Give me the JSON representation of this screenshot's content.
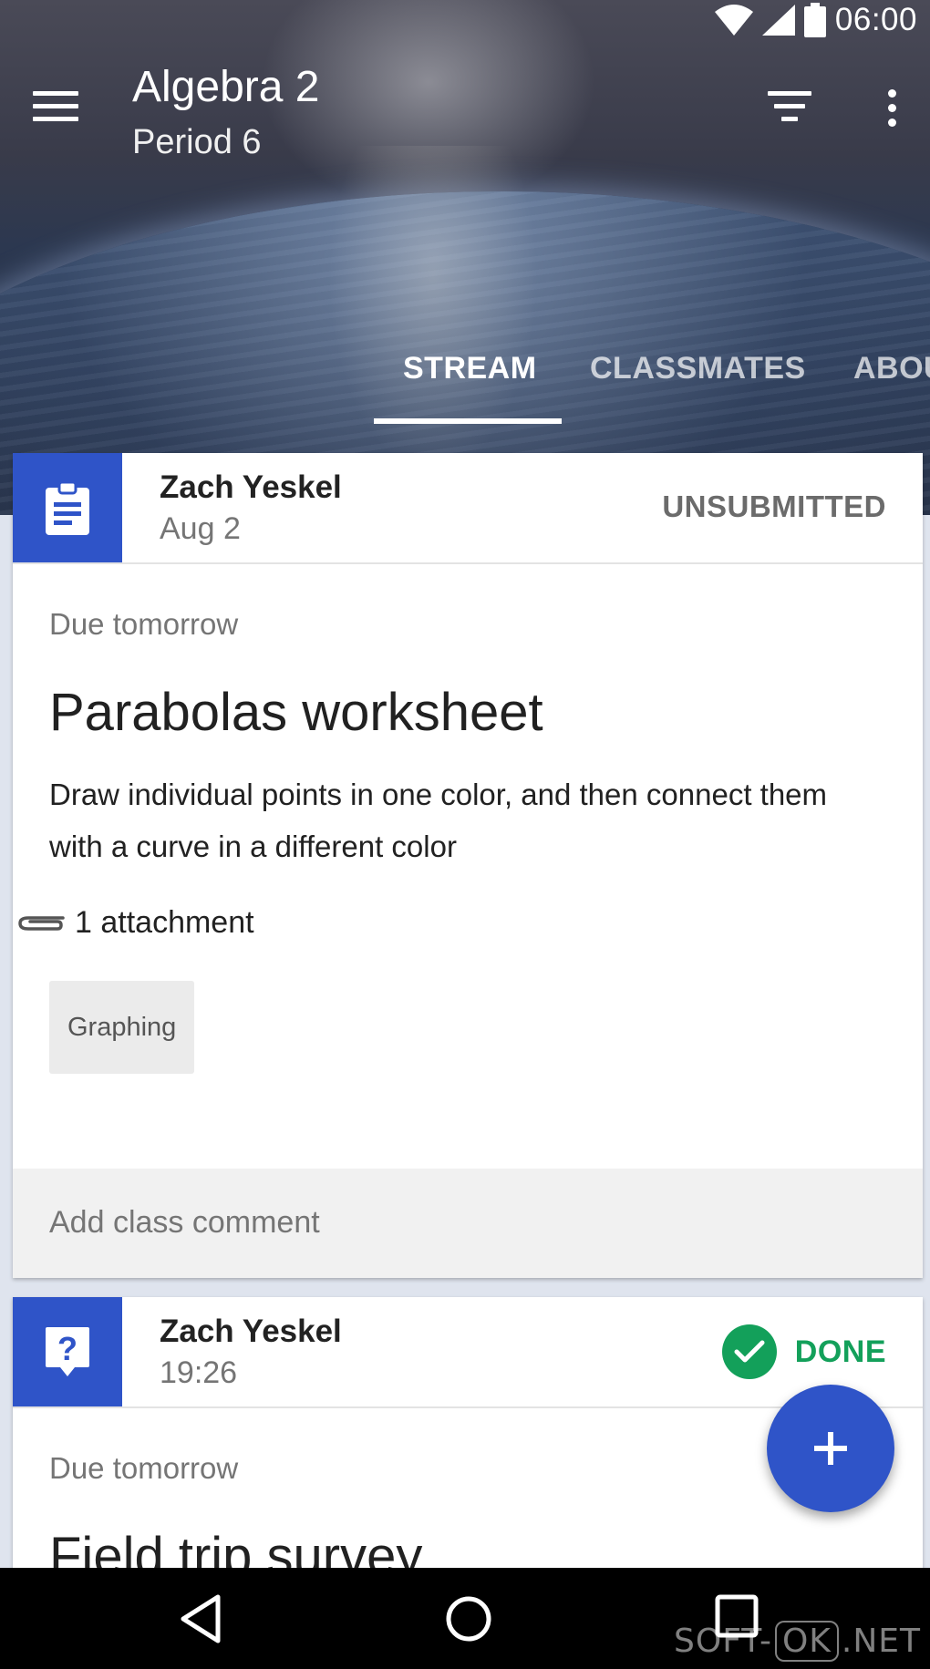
{
  "status_bar": {
    "time": "06:00"
  },
  "header": {
    "class_title": "Algebra 2",
    "class_subtitle": "Period 6",
    "tabs": [
      {
        "label": "STREAM",
        "active": true
      },
      {
        "label": "CLASSMATES",
        "active": false
      },
      {
        "label": "ABOU",
        "active": false
      }
    ]
  },
  "cards": [
    {
      "type": "assignment",
      "author": "Zach Yeskel",
      "posted": "Aug 2",
      "status": "UNSUBMITTED",
      "due": "Due tomorrow",
      "title": "Parabolas worksheet",
      "description": "Draw individual points in one color, and then connect them with a curve in a different color",
      "attachments_label": "1 attachment",
      "attachment_chip": "Graphing",
      "comment_placeholder": "Add class comment"
    },
    {
      "type": "question",
      "author": "Zach Yeskel",
      "posted": "19:26",
      "status": "DONE",
      "due": "Due tomorrow",
      "title": "Field trip survey"
    }
  ],
  "watermark": {
    "part1": "SOFT-",
    "part2": "OK",
    "part3": ".NET"
  },
  "colors": {
    "accent": "#2f54c8",
    "done": "#13a05a"
  },
  "icons": [
    "wifi-icon",
    "signal-icon",
    "battery-icon",
    "menu-icon",
    "filter-icon",
    "more-icon",
    "assignment-icon",
    "question-icon",
    "attachment-icon",
    "check-icon",
    "add-icon",
    "back-icon",
    "home-icon",
    "recents-icon"
  ]
}
